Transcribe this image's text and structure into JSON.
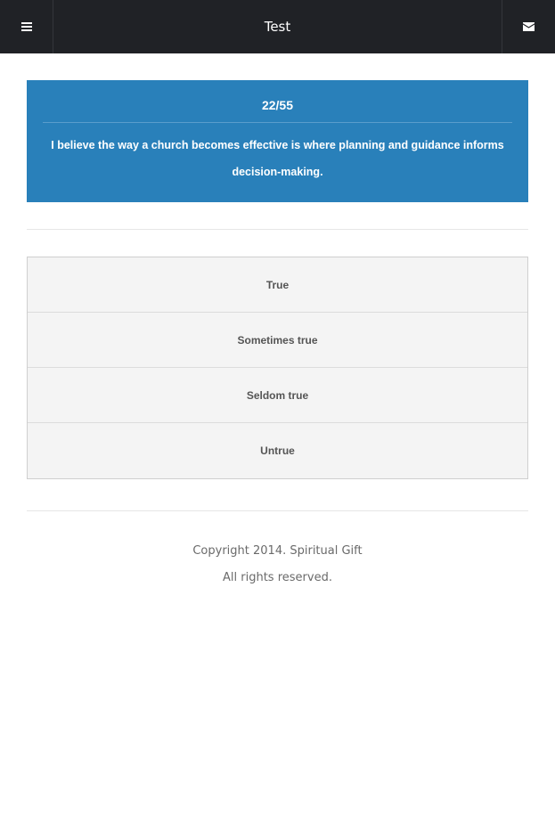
{
  "header": {
    "title": "Test",
    "menu_icon": "hamburger-menu-icon",
    "mail_icon": "envelope-icon",
    "background": "#202226"
  },
  "question": {
    "counter": "22/55",
    "text": "I believe the way a church becomes effective is where planning and guidance informs decision-making.",
    "background": "#2980ba"
  },
  "answers": [
    {
      "label": "True"
    },
    {
      "label": "Sometimes true"
    },
    {
      "label": "Seldom true"
    },
    {
      "label": "Untrue"
    }
  ],
  "footer": {
    "copyright": "Copyright 2014. Spiritual Gift",
    "rights": "All rights reserved."
  }
}
